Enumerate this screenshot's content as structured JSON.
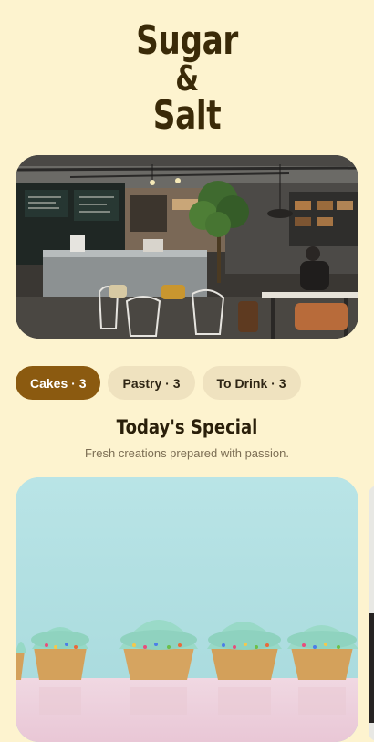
{
  "brand": {
    "line1": "Sugar",
    "line2": "&",
    "line3": "Salt"
  },
  "hero": {
    "image": "coffee-shop-interior-photo"
  },
  "tabs": [
    {
      "label": "Cakes · 3",
      "active": true
    },
    {
      "label": "Pastry · 3",
      "active": false
    },
    {
      "label": "To Drink · 3",
      "active": false
    }
  ],
  "section": {
    "title": "Today's Special",
    "subtitle": "Fresh creations prepared with passion."
  },
  "special": {
    "image": "cupcakes-photo"
  },
  "colors": {
    "background": "#fdf3cf",
    "brand_text": "#3a2a08",
    "tab_active": "#8b5a10",
    "tab_inactive": "#efe2bf",
    "subtitle_text": "#7c6e54"
  }
}
